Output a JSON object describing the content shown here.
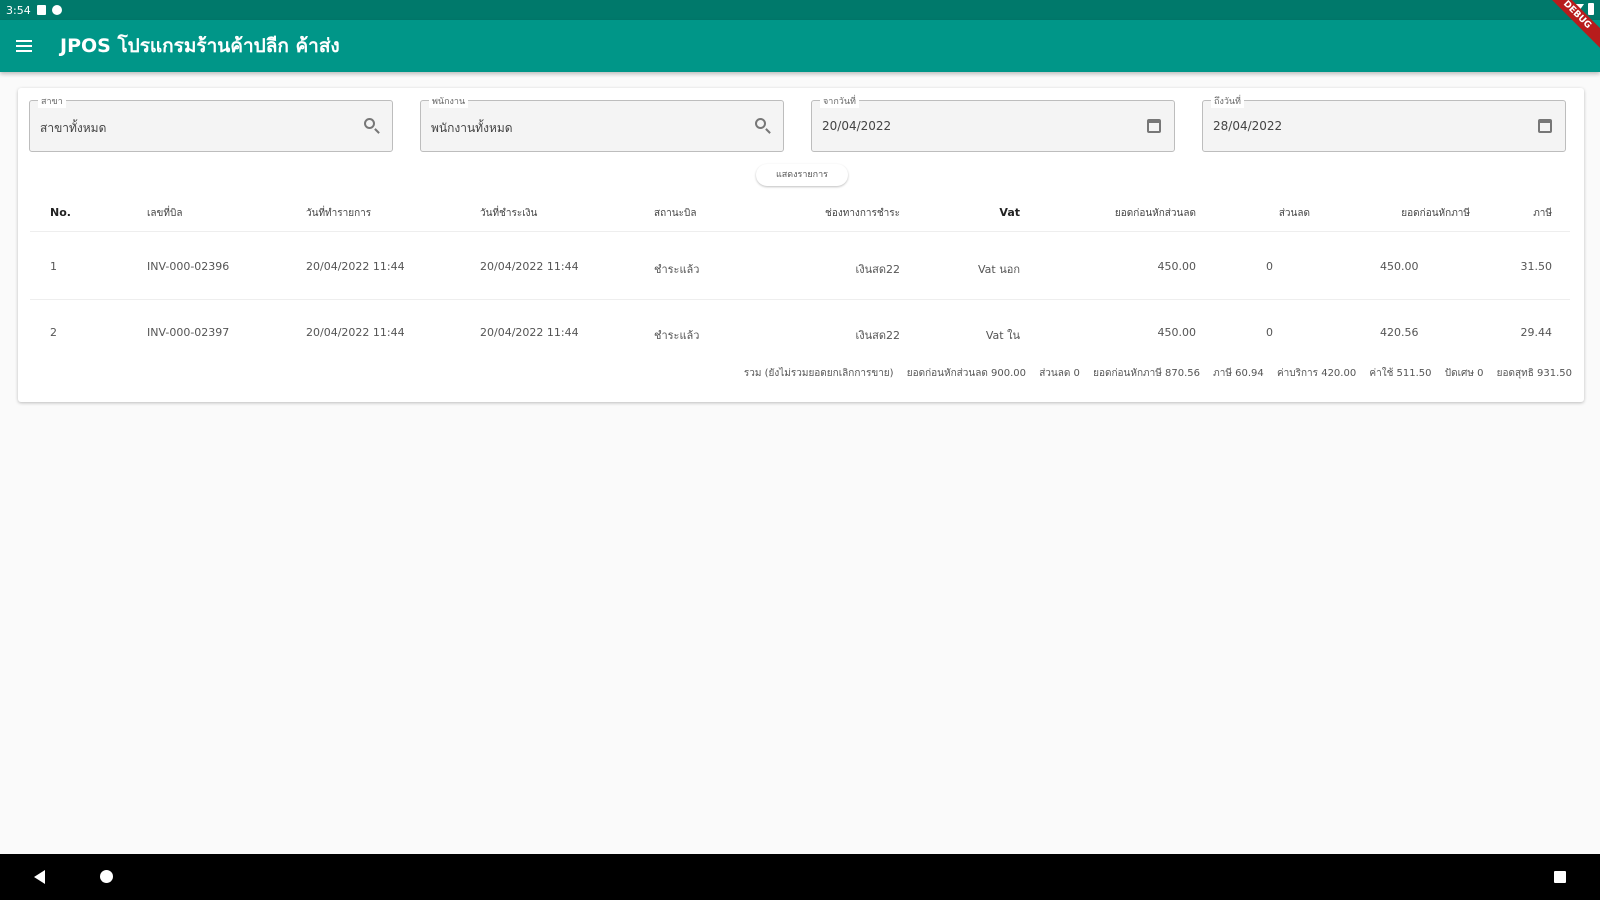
{
  "status_bar": {
    "time": "3:54"
  },
  "debug_banner": "DEBUG",
  "app_bar": {
    "title": "JPOS โปรแกรมร้านค้าปลีก ค้าส่ง"
  },
  "filters": [
    {
      "label": "สาขา",
      "value": "สาขาทั้งหมด",
      "icon": "search-icon"
    },
    {
      "label": "พนักงาน",
      "value": "พนักงานทั้งหมด",
      "icon": "search-icon"
    },
    {
      "label": "จากวันที่",
      "value": "20/04/2022",
      "icon": "calendar-icon"
    },
    {
      "label": "ถึงวันที่",
      "value": "28/04/2022",
      "icon": "calendar-icon"
    }
  ],
  "show_button": "แสดงรายการ",
  "table": {
    "headers": [
      "No.",
      "เลขที่บิล",
      "วันที่ทำรายการ",
      "วันที่ชำระเงิน",
      "สถานะบิล",
      "ช่องทางการชำระ",
      "Vat",
      "ยอดก่อนหักส่วนลด",
      "ส่วนลด",
      "ยอดก่อนหักภาษี",
      "ภาษี"
    ],
    "rows": [
      [
        "1",
        "INV-000-02396",
        "20/04/2022 11:44",
        "20/04/2022 11:44",
        "ชำระแล้ว",
        "เงินสด22",
        "Vat นอก",
        "450.00",
        "0",
        "450.00",
        "31.50"
      ],
      [
        "2",
        "INV-000-02397",
        "20/04/2022 11:44",
        "20/04/2022 11:44",
        "ชำระแล้ว",
        "เงินสด22",
        "Vat ใน",
        "450.00",
        "0",
        "420.56",
        "29.44"
      ]
    ]
  },
  "summary": [
    "รวม (ยังไม่รวมยอดยกเลิกการขาย)",
    "ยอดก่อนหักส่วนลด 900.00",
    "ส่วนลด 0",
    "ยอดก่อนหักภาษี 870.56",
    "ภาษี 60.94",
    "ค่าบริการ 420.00",
    "ค่าใช้ 511.50",
    "ปัดเศษ 0",
    "ยอดสุทธิ 931.50"
  ]
}
